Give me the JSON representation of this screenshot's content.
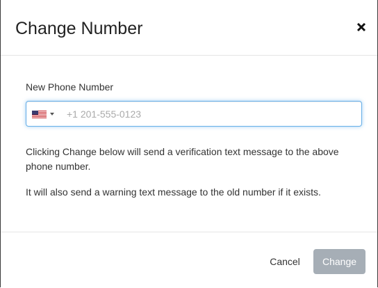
{
  "dialog": {
    "title": "Change Number",
    "close_icon": "close-icon"
  },
  "form": {
    "label": "New Phone Number",
    "country": {
      "flag_icon": "us-flag-icon",
      "selected": "United States"
    },
    "phone": {
      "value": "",
      "placeholder": "+1 201-555-0123"
    },
    "info_1": "Clicking Change below will send a verification text message to the above phone number.",
    "info_2": "It will also send a warning text message to the old number if it exists."
  },
  "footer": {
    "cancel_label": "Cancel",
    "change_label": "Change",
    "change_enabled": false
  },
  "colors": {
    "focus_border": "#66afe9",
    "disabled_button": "#a6aeb6"
  }
}
